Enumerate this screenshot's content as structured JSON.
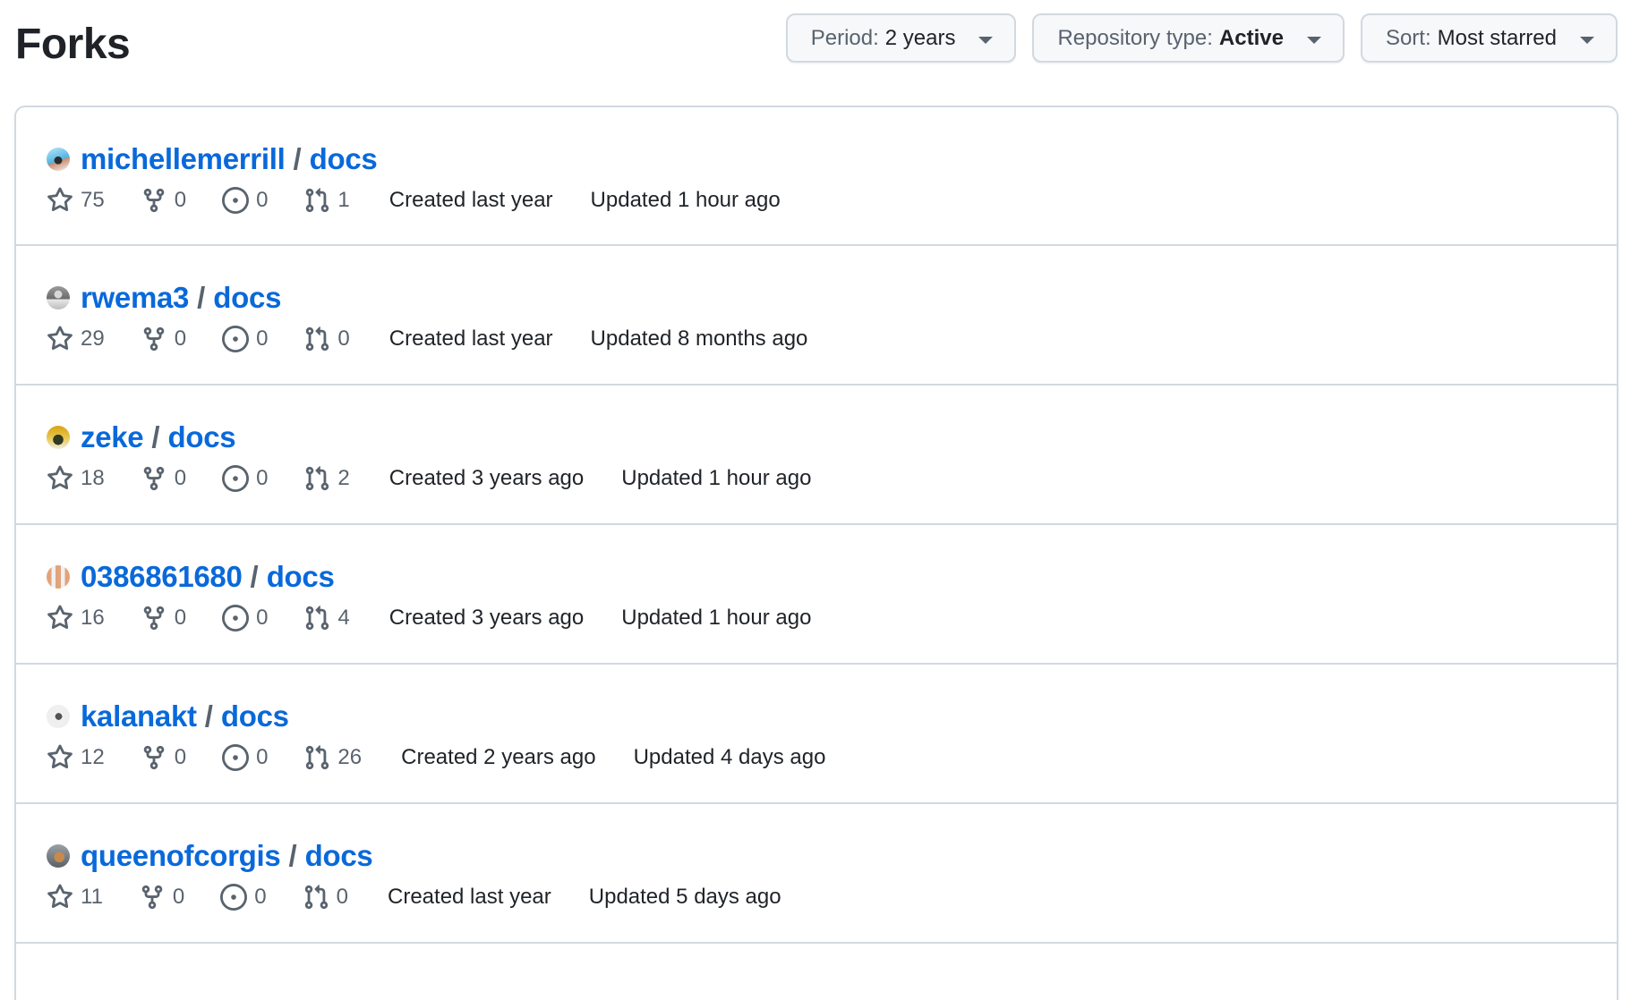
{
  "header": {
    "title": "Forks"
  },
  "filters": [
    {
      "label": "Period:",
      "value": "2 years",
      "bold": false,
      "icon": "triangle-down-icon"
    },
    {
      "label": "Repository type:",
      "value": "Active",
      "bold": true,
      "icon": "triangle-down-icon"
    },
    {
      "label": "Sort:",
      "value": "Most starred",
      "bold": false,
      "icon": "triangle-down-icon"
    }
  ],
  "colors": {
    "link": "#0969da",
    "text": "#1f2328",
    "muted": "#59636e",
    "border": "#d1d9e0",
    "button_bg": "#f6f8fa"
  },
  "forks": [
    {
      "owner": "michellemerrill",
      "separator": "/",
      "repo": "docs",
      "avatar": "surfer-octocat",
      "stars": "75",
      "forks": "0",
      "issues": "0",
      "pull_requests": "1",
      "created": "Created last year",
      "updated": "Updated 1 hour ago"
    },
    {
      "owner": "rwema3",
      "separator": "/",
      "repo": "docs",
      "avatar": "person-photo-gray",
      "stars": "29",
      "forks": "0",
      "issues": "0",
      "pull_requests": "0",
      "created": "Created last year",
      "updated": "Updated 8 months ago"
    },
    {
      "owner": "zeke",
      "separator": "/",
      "repo": "docs",
      "avatar": "portrait-yellow",
      "stars": "18",
      "forks": "0",
      "issues": "0",
      "pull_requests": "2",
      "created": "Created 3 years ago",
      "updated": "Updated 1 hour ago"
    },
    {
      "owner": "0386861680",
      "separator": "/",
      "repo": "docs",
      "avatar": "identicon-orange",
      "stars": "16",
      "forks": "0",
      "issues": "0",
      "pull_requests": "4",
      "created": "Created 3 years ago",
      "updated": "Updated 1 hour ago"
    },
    {
      "owner": "kalanakt",
      "separator": "/",
      "repo": "docs",
      "avatar": "dino",
      "stars": "12",
      "forks": "0",
      "issues": "0",
      "pull_requests": "26",
      "created": "Created 2 years ago",
      "updated": "Updated 4 days ago"
    },
    {
      "owner": "queenofcorgis",
      "separator": "/",
      "repo": "docs",
      "avatar": "corgi-photo",
      "stars": "11",
      "forks": "0",
      "issues": "0",
      "pull_requests": "0",
      "created": "Created last year",
      "updated": "Updated 5 days ago"
    }
  ]
}
